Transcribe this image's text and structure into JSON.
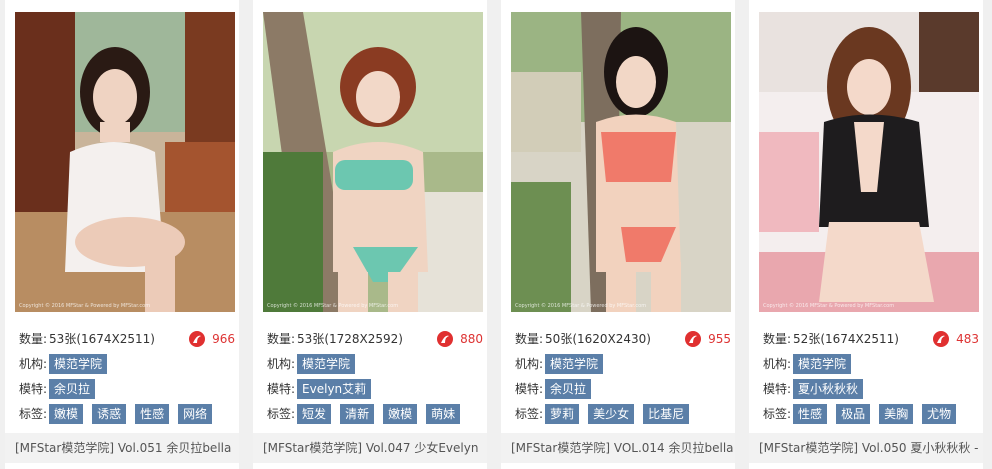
{
  "labels": {
    "count": "数量:",
    "org": "机构:",
    "model": "模特:",
    "tags": "标签:"
  },
  "watermark": "Copyright © 2016 MFStar & Powered by MFStar.com",
  "colors": {
    "tag_bg": "#5b7fa8",
    "heat_red": "#d33",
    "title_bg": "#f2f2f2"
  },
  "cards": [
    {
      "count": "53张(1674X2511)",
      "views": "966",
      "org": "模范学院",
      "model": "余贝拉",
      "tags": [
        "嫩模",
        "诱惑",
        "性感",
        "网络"
      ],
      "title": "[MFStar模范学院] Vol.051 余贝拉bella"
    },
    {
      "count": "53张(1728X2592)",
      "views": "880",
      "org": "模范学院",
      "model": "Evelyn艾莉",
      "tags": [
        "短发",
        "清新",
        "嫩模",
        "萌妹"
      ],
      "title": "[MFStar模范学院] Vol.047 少女Evelyn"
    },
    {
      "count": "50张(1620X2430)",
      "views": "955",
      "org": "模范学院",
      "model": "余贝拉",
      "tags": [
        "萝莉",
        "美少女",
        "比基尼"
      ],
      "title": "[MFStar模范学院] VOL.014 余贝拉bella"
    },
    {
      "count": "52张(1674X2511)",
      "views": "483",
      "org": "模范学院",
      "model": "夏小秋秋秋",
      "tags": [
        "性感",
        "极品",
        "美胸",
        "尤物"
      ],
      "title": "[MFStar模范学院] Vol.050 夏小秋秋秋 -"
    }
  ]
}
